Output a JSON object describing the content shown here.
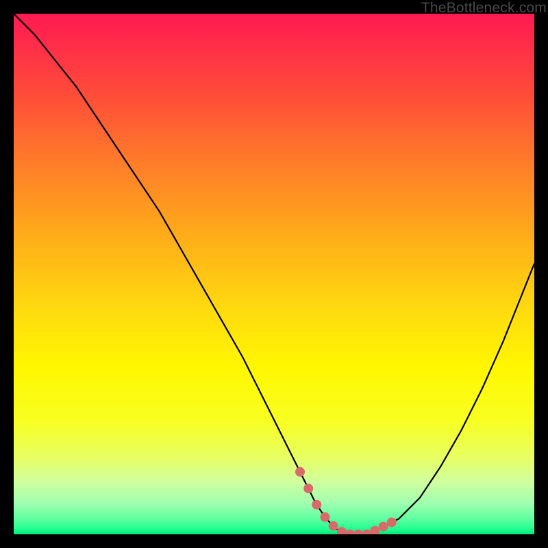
{
  "chart_data": {
    "type": "line",
    "title": "",
    "xlabel": "",
    "ylabel": "",
    "xlim": [
      0,
      100
    ],
    "ylim": [
      0,
      100
    ],
    "series": [
      {
        "name": "bottleneck-curve",
        "x": [
          0,
          4,
          8,
          12,
          16,
          20,
          24,
          28,
          32,
          36,
          40,
          44,
          48,
          52,
          54,
          56,
          58,
          60,
          62,
          64,
          66,
          68,
          70,
          74,
          78,
          82,
          86,
          90,
          94,
          98,
          100
        ],
        "values": [
          100,
          96,
          91,
          86,
          80,
          74,
          68,
          62,
          55,
          48,
          41,
          34,
          26,
          18,
          14,
          10,
          6,
          3,
          1,
          0,
          0,
          0,
          1,
          3,
          7,
          13,
          20,
          28,
          37,
          47,
          52
        ]
      }
    ],
    "annotations": {
      "optimum_band": {
        "x_start": 55,
        "x_end": 73,
        "style": "coral-dots"
      }
    },
    "background": {
      "type": "gradient-vertical",
      "stops": [
        {
          "pos": 0.0,
          "color": "#ff1a52"
        },
        {
          "pos": 0.5,
          "color": "#ffd810"
        },
        {
          "pos": 1.0,
          "color": "#00e878"
        }
      ]
    }
  },
  "watermark": "TheBottleneck.com",
  "colors": {
    "curve": "#000000",
    "accent_dots": "#d96a6a",
    "frame": "#000000"
  }
}
